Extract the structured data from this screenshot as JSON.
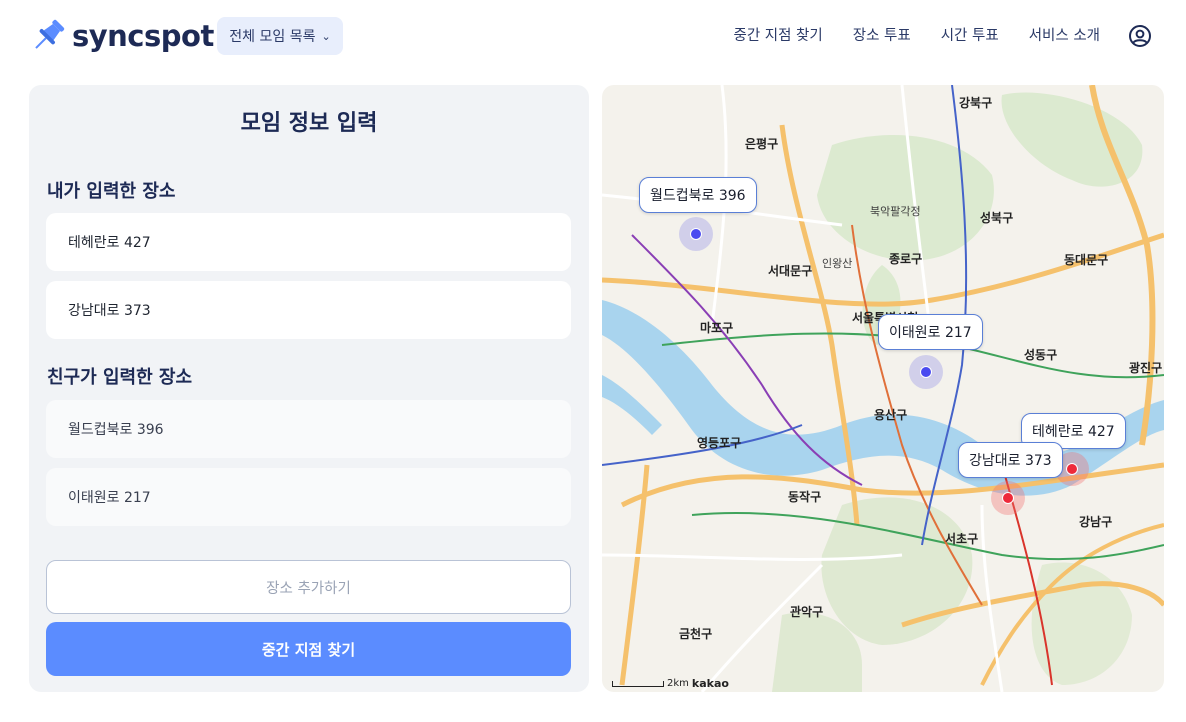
{
  "app": {
    "brand": "syncspot",
    "meeting_select": "전체 모임 목록"
  },
  "nav": {
    "items": [
      "중간 지점 찾기",
      "장소 투표",
      "시간 투표",
      "서비스 소개"
    ]
  },
  "form": {
    "title": "모임 정보 입력",
    "my_section_title": "내가 입력한 장소",
    "my_places": [
      "테헤란로 427",
      "강남대로 373"
    ],
    "friend_section_title": "친구가 입력한 장소",
    "friend_places": [
      "월드컵북로 396",
      "이태원로 217"
    ],
    "add_button": "장소 추가하기",
    "find_button": "중간 지점 찾기"
  },
  "map": {
    "markers": [
      {
        "label": "월드컵북로 396",
        "kind": "friend"
      },
      {
        "label": "이태원로 217",
        "kind": "friend"
      },
      {
        "label": "테헤란로 427",
        "kind": "mine"
      },
      {
        "label": "강남대로 373",
        "kind": "mine"
      }
    ],
    "place_names": {
      "gangbuk": "강북구",
      "eunpyeong": "은평구",
      "seongbuk": "성북구",
      "bukak": "북악팔각정",
      "jongno": "종로구",
      "seodaemun": "서대문구",
      "inwang": "인왕산",
      "dongdaemun": "동대문구",
      "mapo": "마포구",
      "seoul_hall": "서울특별시청",
      "seongdong": "성동구",
      "yongsan": "용산구",
      "yeongdeungpo": "영등포구",
      "dongjak": "동작구",
      "seocho": "서초구",
      "gangnam": "강남구",
      "gwanak": "관악구",
      "geumcheon": "금천구",
      "gwangjin": "광진구"
    },
    "scale": "2km",
    "provider": "kakao"
  },
  "colors": {
    "primary": "#5b8cff",
    "brand_dark": "#1d2a55",
    "friend_marker": "#4a4af0",
    "my_marker": "#ee2a3a",
    "river": "#a9d4ee"
  }
}
